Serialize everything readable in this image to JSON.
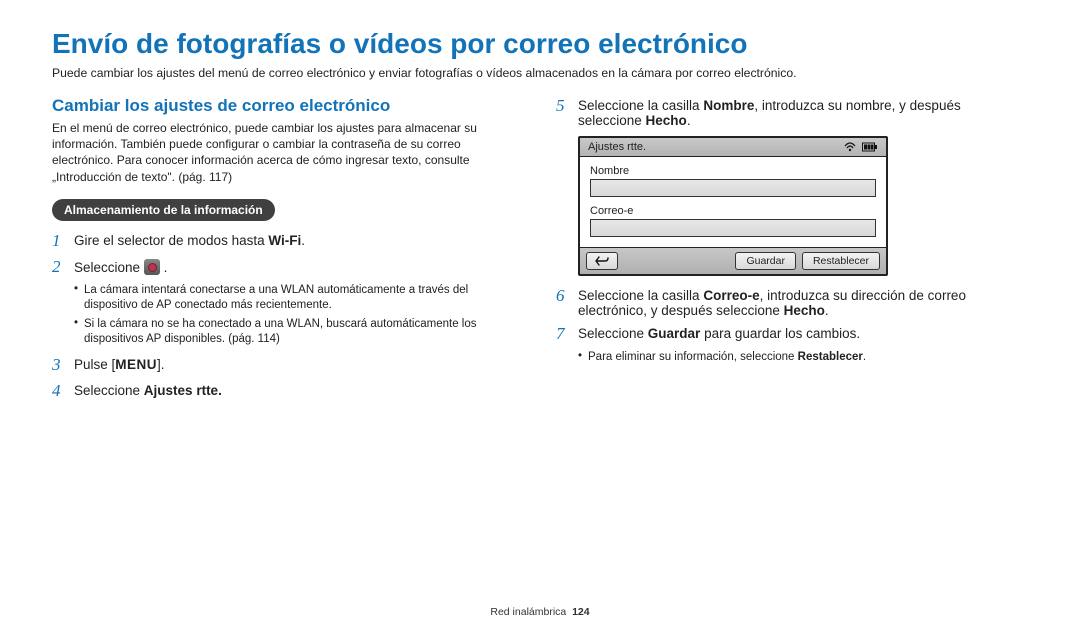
{
  "title": "Envío de fotografías o vídeos por correo electrónico",
  "intro": "Puede cambiar los ajustes del menú de correo electrónico y enviar fotografías o vídeos almacenados en la cámara por correo electrónico.",
  "left": {
    "section_title": "Cambiar los ajustes de correo electrónico",
    "section_desc": "En el menú de correo electrónico, puede cambiar los ajustes para almacenar su información. También puede configurar o cambiar la contraseña de su correo electrónico. Para conocer información acerca de cómo ingresar texto, consulte „Introducción de texto\". (pág. 117)",
    "pill": "Almacenamiento de la información",
    "step1_pre": "Gire el selector de modos hasta ",
    "step1_wifi": "Wi-Fi",
    "step2": "Seleccione ",
    "step2_bullets": [
      "La cámara intentará conectarse a una WLAN automáticamente a través del dispositivo de AP conectado más recientemente.",
      "Si la cámara no se ha conectado a una WLAN, buscará automáticamente los dispositivos AP disponibles. (pág. 114)"
    ],
    "step3_pre": "Pulse [",
    "step3_menu": "MENU",
    "step3_post": "].",
    "step4_pre": "Seleccione ",
    "step4_bold": "Ajustes rtte."
  },
  "right": {
    "step5_pre": "Seleccione la casilla ",
    "step5_b1": "Nombre",
    "step5_mid": ", introduzca su nombre, y después seleccione ",
    "step5_b2": "Hecho",
    "step5_post": ".",
    "screenshot": {
      "title": "Ajustes rtte.",
      "field1": "Nombre",
      "field2": "Correo-e",
      "btn_save": "Guardar",
      "btn_reset": "Restablecer"
    },
    "step6_pre": "Seleccione la casilla ",
    "step6_b1": "Correo-e",
    "step6_mid": ", introduzca su dirección de correo electrónico, y después seleccione ",
    "step6_b2": "Hecho",
    "step6_post": ".",
    "step7_pre": "Seleccione ",
    "step7_b1": "Guardar",
    "step7_post": " para guardar los cambios.",
    "step7_bullets_pre": "Para eliminar su información, seleccione ",
    "step7_bullets_b": "Restablecer",
    "step7_bullets_post": "."
  },
  "footer": {
    "section": "Red inalámbrica",
    "page": "124"
  }
}
